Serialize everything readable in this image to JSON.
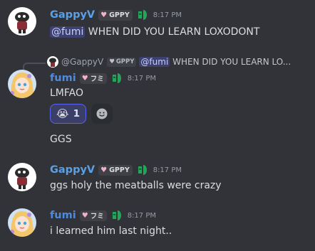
{
  "messages": [
    {
      "username": "GappyV",
      "tag": "GPPY",
      "time": "8:17 PM",
      "mention": "@fumi",
      "text": "WHEN DID YOU LEARN LOXODONT"
    },
    {
      "reply": {
        "username": "@GappyV",
        "tag": "GPPY",
        "mention": "@fumi",
        "text": "WHEN DID YOU LEARN LO..."
      },
      "username": "fumi",
      "tag": "フミ",
      "time": "8:17 PM",
      "text": "LMFAO",
      "reactions": [
        {
          "emoji": "😭",
          "count": "1"
        }
      ],
      "followup": "GGS"
    },
    {
      "username": "GappyV",
      "tag": "GPPY",
      "time": "8:17 PM",
      "text": "ggs holy the meatballs were crazy"
    },
    {
      "username": "fumi",
      "tag": "フミ",
      "time": "8:17 PM",
      "text": "i learned him last night.."
    }
  ],
  "colors": {
    "background": "#323339",
    "gappy_name": "#5aa0e6",
    "fumi_name": "#4c8be0",
    "mention_bg": "#4a4f82",
    "game_icon": "#23a55a"
  }
}
